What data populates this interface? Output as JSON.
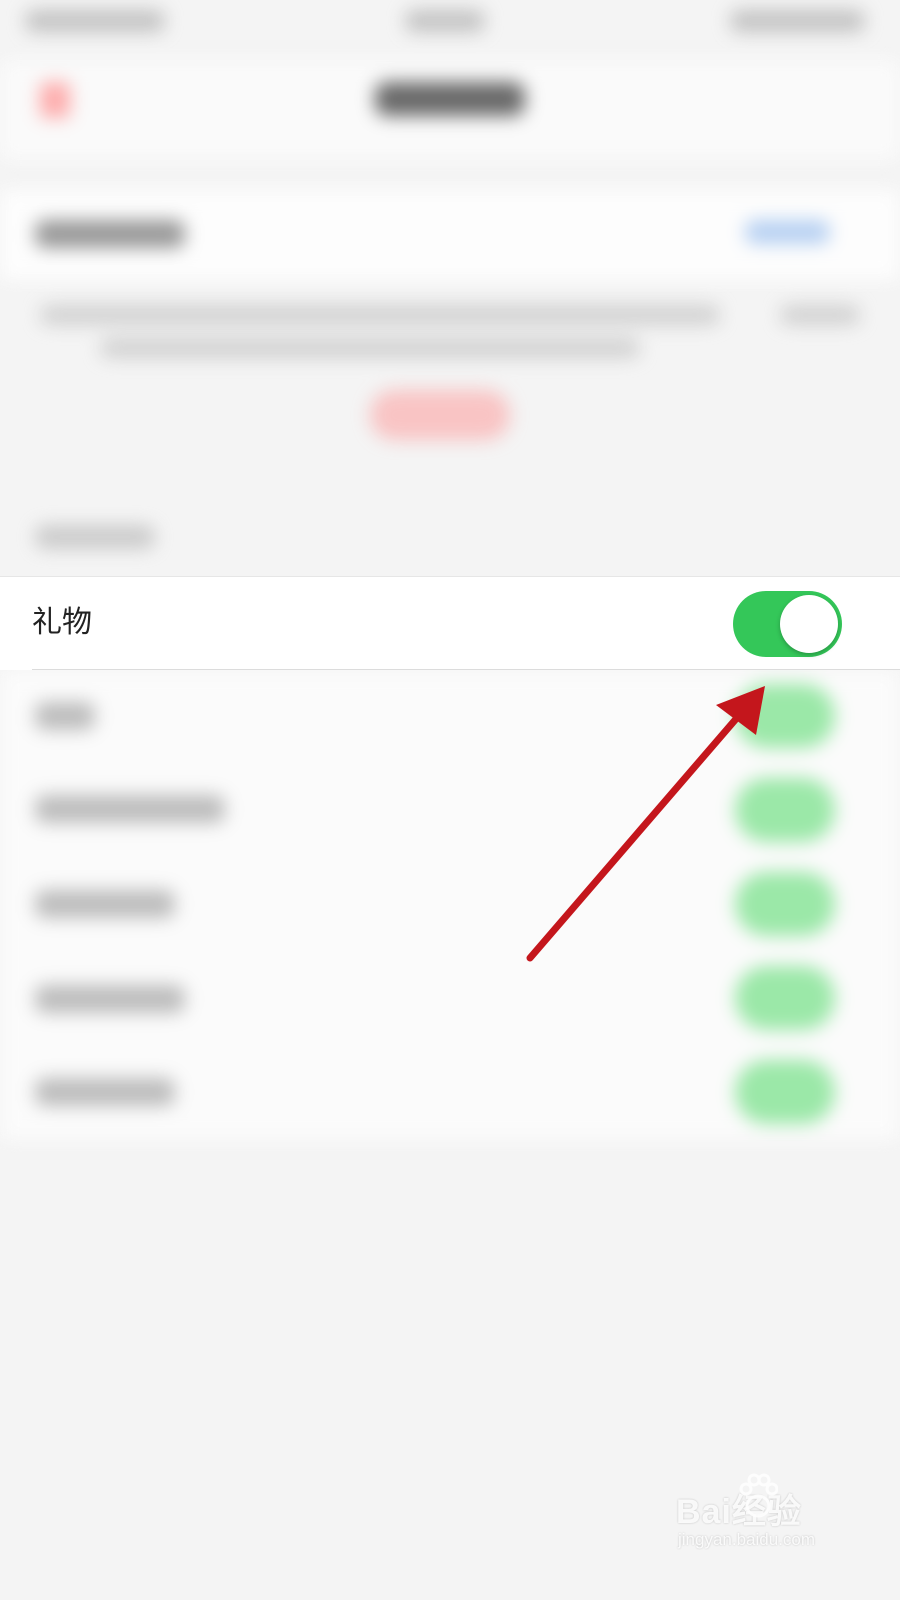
{
  "settings_row": {
    "label": "礼物",
    "toggle_on": true
  },
  "colors": {
    "toggle_on": "#34c759",
    "arrow": "#c4161c",
    "background": "#f4f4f4"
  },
  "watermark": {
    "brand": "Bai经验",
    "url": "jingyan.baidu.com"
  }
}
